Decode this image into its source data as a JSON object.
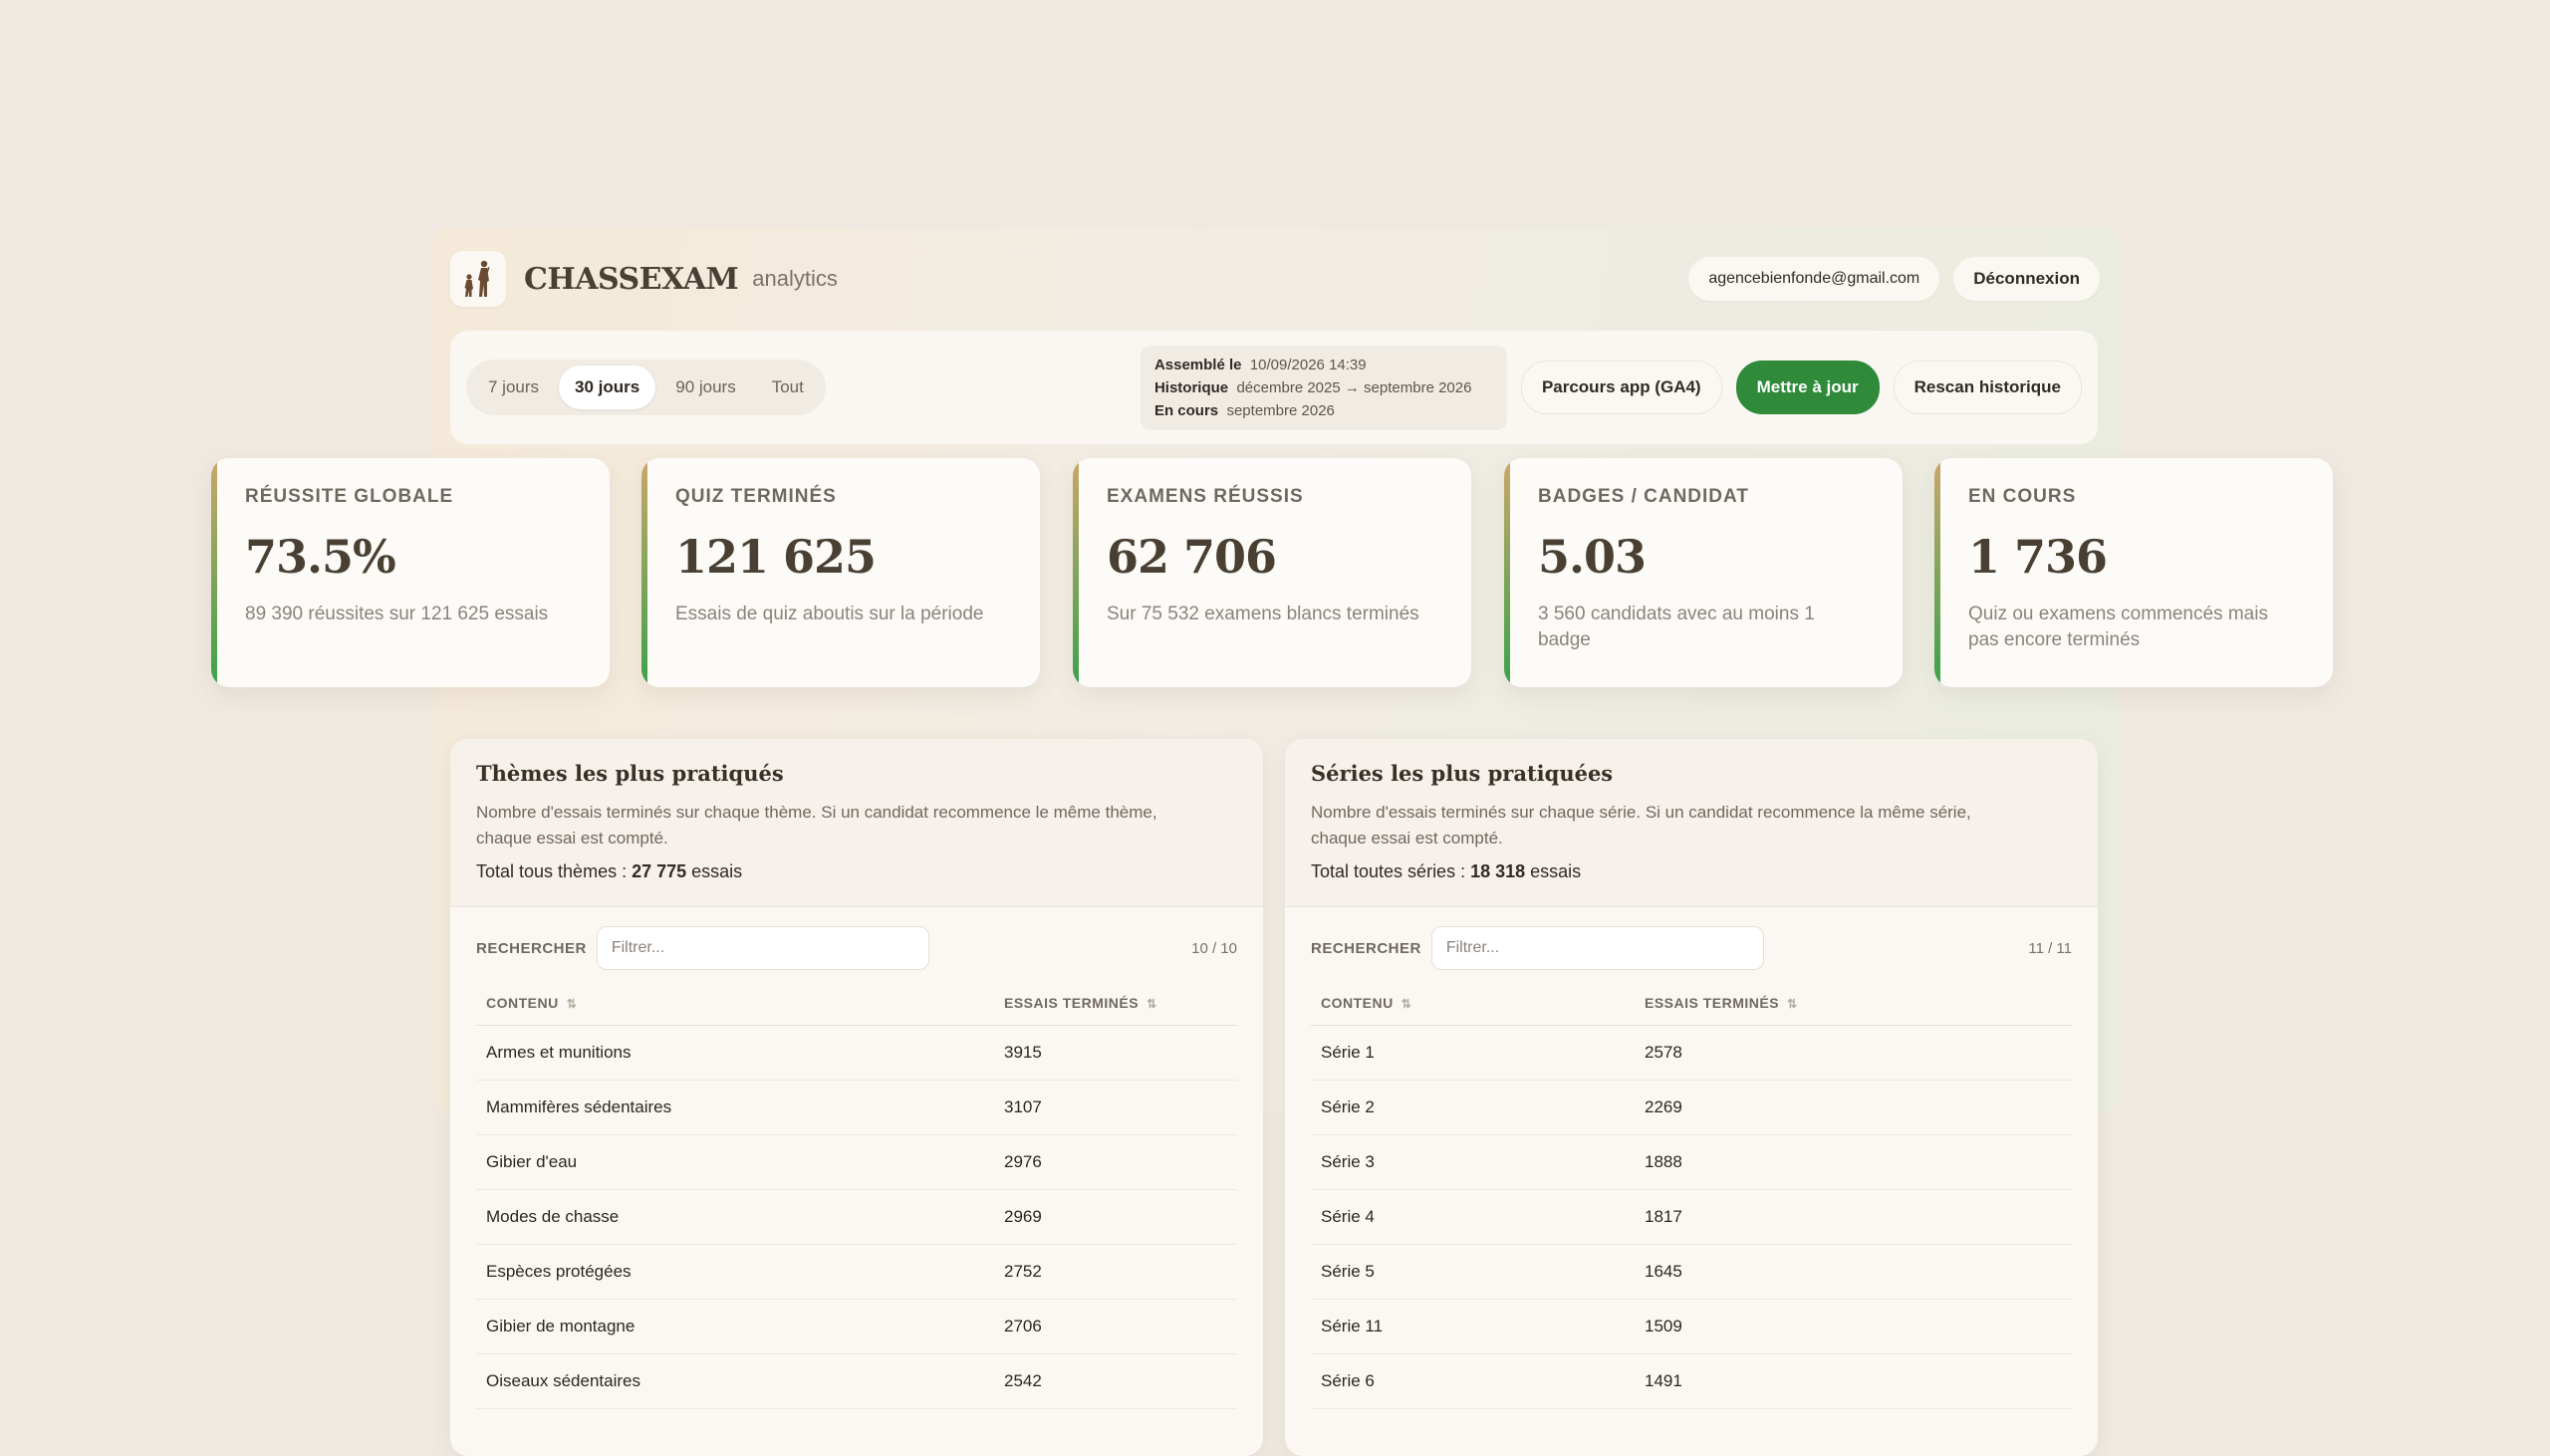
{
  "header": {
    "brand": "CHASSEXAM",
    "subtitle": "analytics",
    "email": "agencebienfonde@gmail.com",
    "logout": "Déconnexion"
  },
  "toolbar": {
    "ranges": [
      "7 jours",
      "30 jours",
      "90 jours",
      "Tout"
    ],
    "active_range": "30 jours",
    "meta": {
      "assembled_label": "Assemblé le",
      "assembled_value": "10/09/2026 14:39",
      "history_label": "Historique",
      "history_value": "décembre 2025 → septembre 2026",
      "current_label": "En cours",
      "current_value": "septembre 2026"
    },
    "btn_ga4": "Parcours app (GA4)",
    "btn_update": "Mettre à jour",
    "btn_rescan": "Rescan historique"
  },
  "kpis": [
    {
      "label": "RÉUSSITE GLOBALE",
      "value": "73.5%",
      "desc": "89 390 réussites sur 121 625 essais"
    },
    {
      "label": "QUIZ TERMINÉS",
      "value": "121 625",
      "desc": "Essais de quiz aboutis sur la période"
    },
    {
      "label": "EXAMENS RÉUSSIS",
      "value": "62 706",
      "desc": "Sur 75 532 examens blancs terminés"
    },
    {
      "label": "BADGES / CANDIDAT",
      "value": "5.03",
      "desc": "3 560 candidats avec au moins 1 badge"
    },
    {
      "label": "EN COURS",
      "value": "1 736",
      "desc": "Quiz ou examens commencés mais pas encore terminés"
    }
  ],
  "themes": {
    "title": "Thèmes les plus pratiqués",
    "desc": "Nombre d'essais terminés sur chaque thème. Si un candidat recommence le même thème, chaque essai est compté.",
    "total_prefix": "Total tous thèmes : ",
    "total_value": "27 775",
    "total_suffix": " essais",
    "search_label": "RECHERCHER",
    "search_placeholder": "Filtrer...",
    "count": "10 / 10",
    "col1": "CONTENU",
    "col2": "ESSAIS TERMINÉS",
    "rows": [
      {
        "name": "Armes et munitions",
        "value": "3915"
      },
      {
        "name": "Mammifères sédentaires",
        "value": "3107"
      },
      {
        "name": "Gibier d'eau",
        "value": "2976"
      },
      {
        "name": "Modes de chasse",
        "value": "2969"
      },
      {
        "name": "Espèces protégées",
        "value": "2752"
      },
      {
        "name": "Gibier de montagne",
        "value": "2706"
      },
      {
        "name": "Oiseaux sédentaires",
        "value": "2542"
      }
    ]
  },
  "series": {
    "title": "Séries les plus pratiquées",
    "desc": "Nombre d'essais terminés sur chaque série. Si un candidat recommence la même série, chaque essai est compté.",
    "total_prefix": "Total toutes séries : ",
    "total_value": "18 318",
    "total_suffix": " essais",
    "search_label": "RECHERCHER",
    "search_placeholder": "Filtrer...",
    "count": "11 / 11",
    "col1": "CONTENU",
    "col2": "ESSAIS TERMINÉS",
    "rows": [
      {
        "name": "Série 1",
        "value": "2578"
      },
      {
        "name": "Série 2",
        "value": "2269"
      },
      {
        "name": "Série 3",
        "value": "1888"
      },
      {
        "name": "Série 4",
        "value": "1817"
      },
      {
        "name": "Série 5",
        "value": "1645"
      },
      {
        "name": "Série 11",
        "value": "1509"
      },
      {
        "name": "Série 6",
        "value": "1491"
      }
    ]
  }
}
